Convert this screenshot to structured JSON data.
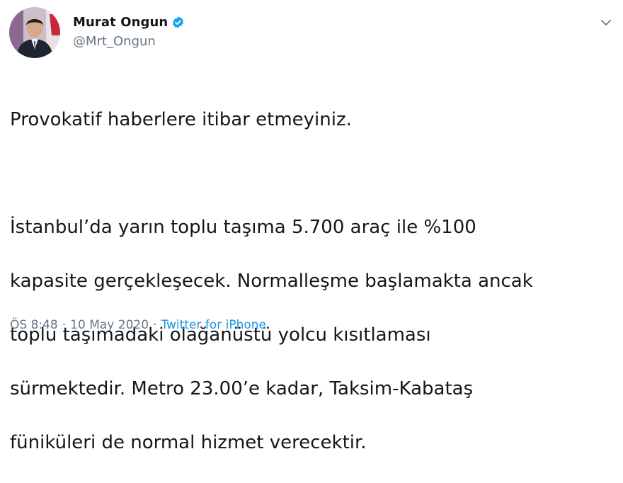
{
  "author": {
    "display_name": "Murat Ongun",
    "handle": "@Mrt_Ongun",
    "verified_icon": "verified-badge-icon"
  },
  "tweet": {
    "paragraph_1": "Provokatif haberlere itibar etmeyiniz.",
    "paragraph_2_lines": [
      "İstanbul’da yarın toplu taşıma 5.700 araç ile %100",
      "kapasite gerçekleşecek. Normalleşme başlamakta ancak",
      "toplu taşımadaki olağanüstü yolcu kısıtlaması",
      "sürmektedir. Metro 23.00’e kadar, Taksim-Kabataş",
      "füniküleri de normal hizmet verecektir."
    ]
  },
  "meta": {
    "time": "ÖS 8:48",
    "separator_1": "·",
    "date": "10 May 2020",
    "separator_2": "·",
    "source": "Twitter for iPhone"
  },
  "colors": {
    "text": "#14171a",
    "secondary": "#657786",
    "link": "#1b95e0",
    "verified": "#1da1f2"
  }
}
